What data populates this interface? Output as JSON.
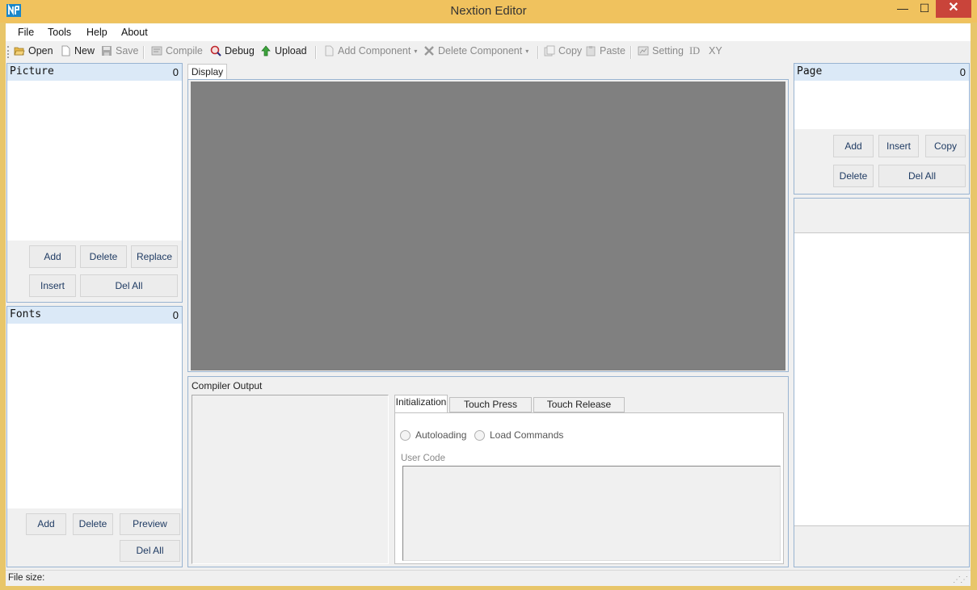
{
  "window": {
    "title": "Nextion Editor",
    "controls": {
      "minimize": "—",
      "maximize": "☐",
      "close": "✕"
    }
  },
  "menu": {
    "items": [
      "File",
      "Tools",
      "Help",
      "About"
    ]
  },
  "toolbar": {
    "open": "Open",
    "new": "New",
    "save": "Save",
    "compile": "Compile",
    "debug": "Debug",
    "upload": "Upload",
    "add_component": "Add Component",
    "delete_component": "Delete Component",
    "copy": "Copy",
    "paste": "Paste",
    "setting": "Setting",
    "id": "ID",
    "xy": "XY"
  },
  "picture_panel": {
    "title": "Picture",
    "count": "0",
    "buttons": {
      "add": "Add",
      "delete": "Delete",
      "replace": "Replace",
      "insert": "Insert",
      "del_all": "Del All"
    }
  },
  "fonts_panel": {
    "title": "Fonts",
    "count": "0",
    "buttons": {
      "add": "Add",
      "delete": "Delete",
      "preview": "Preview",
      "del_all": "Del All"
    }
  },
  "display": {
    "tab": "Display",
    "canvas_color": "#808080"
  },
  "compiler": {
    "label": "Compiler Output",
    "tabs": [
      "Initialization",
      "Touch Press Event",
      "Touch Release Event"
    ],
    "radio_autoloading": "Autoloading",
    "radio_load_commands": "Load Commands",
    "user_code_label": "User Code"
  },
  "page_panel": {
    "title": "Page",
    "count": "0",
    "buttons": {
      "add": "Add",
      "insert": "Insert",
      "copy": "Copy",
      "delete": "Delete",
      "del_all": "Del All"
    }
  },
  "status": {
    "file_size_label": "File size:",
    "grip": "⋰⋰"
  },
  "colors": {
    "title_bar": "#f0c25e",
    "close_button": "#c9443a",
    "panel_header": "#dbe9f7",
    "panel_border": "#99b4d1"
  }
}
